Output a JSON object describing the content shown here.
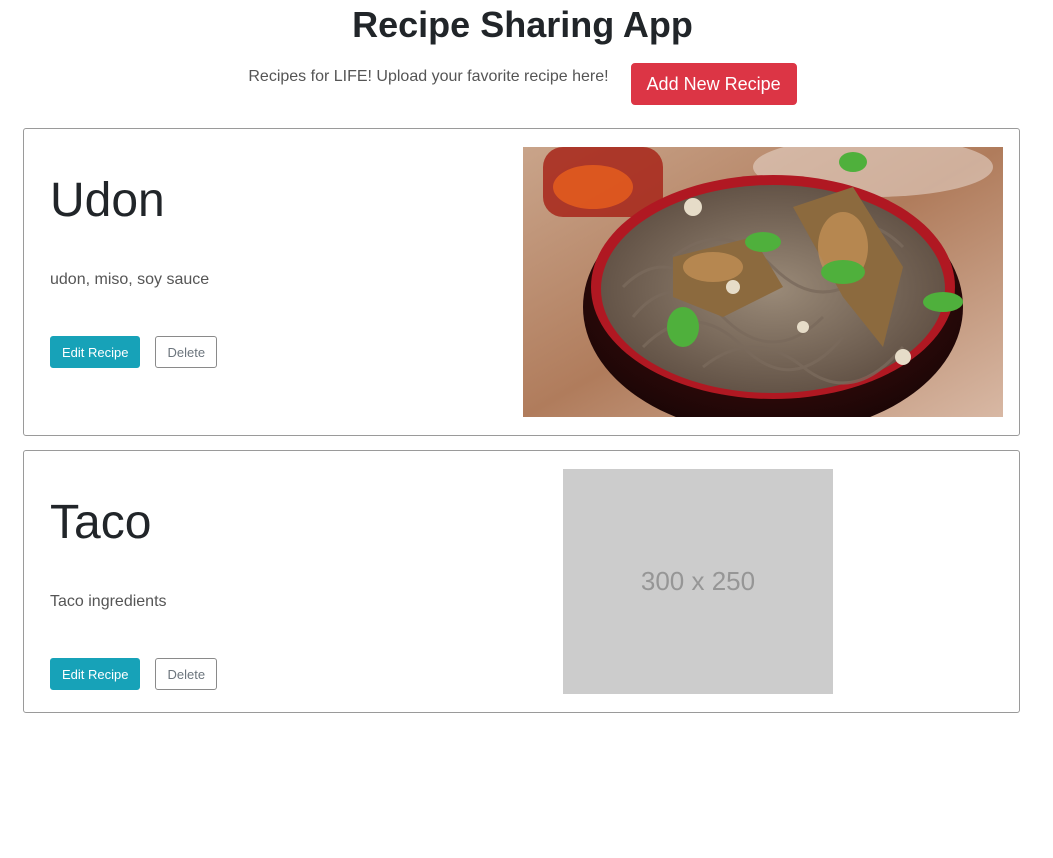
{
  "header": {
    "title": "Recipe Sharing App",
    "tagline": "Recipes for LIFE! Upload your favorite recipe here!",
    "add_button_label": "Add New Recipe"
  },
  "recipes": [
    {
      "name": "Udon",
      "ingredients": "udon, miso, soy sauce",
      "edit_label": "Edit Recipe",
      "delete_label": "Delete",
      "image": "noodle-bowl-photo"
    },
    {
      "name": "Taco",
      "ingredients": "Taco ingredients",
      "edit_label": "Edit Recipe",
      "delete_label": "Delete",
      "image_placeholder_text": "300 x 250"
    }
  ],
  "colors": {
    "add_button": "#dc3545",
    "edit_button": "#17a2b8",
    "placeholder_bg": "#cccccc"
  }
}
